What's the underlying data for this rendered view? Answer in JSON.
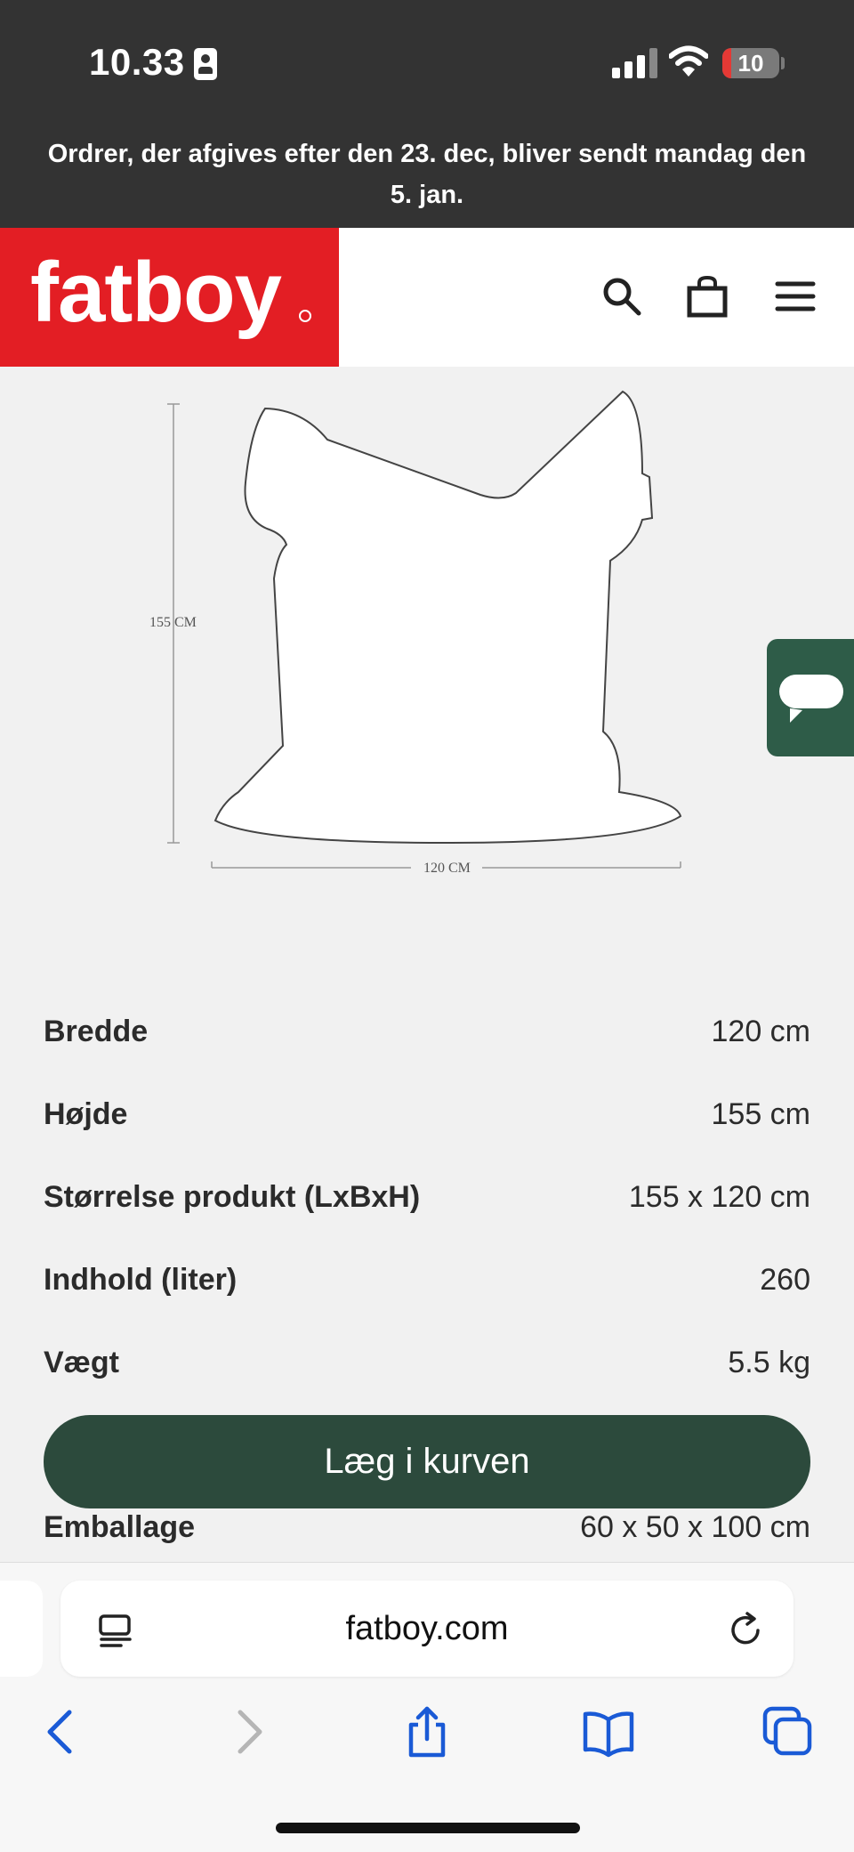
{
  "status_bar": {
    "time": "10.33",
    "battery": "10"
  },
  "announcement": "Ordrer, der afgives efter den 23. dec, bliver sendt mandag den 5. jan.",
  "brand": {
    "logo": "fatboy",
    "color": "#e31e24"
  },
  "header_icons": [
    "search-icon",
    "bag-icon",
    "menu-icon"
  ],
  "drawing": {
    "height_label": "155 CM",
    "width_label": "120 CM"
  },
  "specs": [
    {
      "label": "Bredde",
      "value": "120 cm"
    },
    {
      "label": "Højde",
      "value": "155 cm"
    },
    {
      "label": "Størrelse produkt (LxBxH)",
      "value": "155 x 120 cm"
    },
    {
      "label": "Indhold (liter)",
      "value": "260"
    },
    {
      "label": "Vægt",
      "value": "5.5 kg"
    },
    {
      "label": "Emballage",
      "value": "60 x 50 x 100 cm"
    }
  ],
  "cart_button": "Læg i kurven",
  "browser": {
    "url": "fatboy.com"
  },
  "colors": {
    "dark_bar": "#333333",
    "cta": "#2c4a3c",
    "chat": "#2e5c48",
    "safari_blue": "#1a5ad6"
  }
}
